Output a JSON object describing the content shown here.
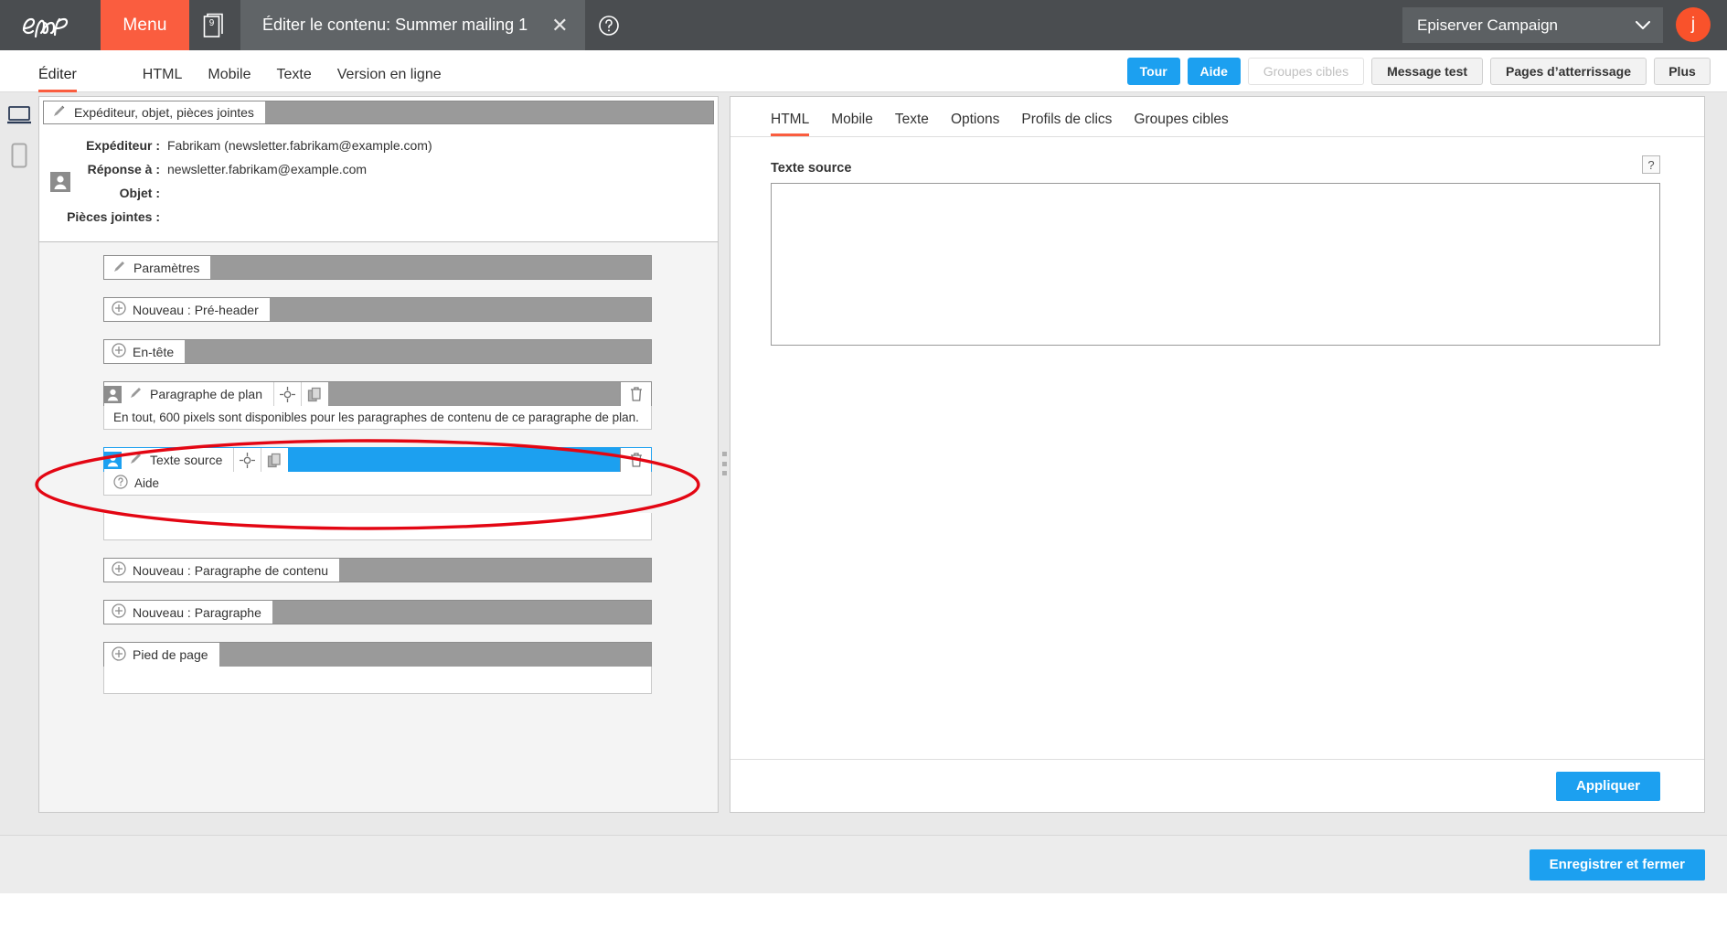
{
  "topbar": {
    "logo_name": "episerver-logo",
    "menu_label": "Menu",
    "doc_badge": "9",
    "title": "Éditer le contenu: Summer mailing 1",
    "close_label": "✕",
    "help_label": "?",
    "environment": "Episerver Campaign",
    "avatar_initial": "j"
  },
  "subbar": {
    "tabs": [
      {
        "label": "Éditer",
        "active": true
      },
      {
        "label": "HTML",
        "active": false
      },
      {
        "label": "Mobile",
        "active": false
      },
      {
        "label": "Texte",
        "active": false
      },
      {
        "label": "Version en ligne",
        "active": false
      }
    ],
    "buttons": [
      {
        "label": "Tour",
        "style": "blue"
      },
      {
        "label": "Aide",
        "style": "blue"
      },
      {
        "label": "Groupes cibles",
        "style": "ghost"
      },
      {
        "label": "Message test",
        "style": "grey"
      },
      {
        "label": "Pages d’atterrissage",
        "style": "grey"
      },
      {
        "label": "Plus",
        "style": "grey"
      }
    ]
  },
  "devicebar": {
    "desktop_icon": "desktop-icon",
    "mobile_icon": "mobile-icon"
  },
  "sender_panel": {
    "header_label": "Expéditeur, objet, pièces jointes",
    "rows": [
      {
        "label": "Expéditeur :",
        "value": "Fabrikam (newsletter.fabrikam@example.com)"
      },
      {
        "label": "Réponse à :",
        "value": "newsletter.fabrikam@example.com"
      },
      {
        "label": "Objet :",
        "value": ""
      },
      {
        "label": "Pièces jointes :",
        "value": ""
      }
    ]
  },
  "blocks": [
    {
      "type": "edit",
      "label": "Paramètres"
    },
    {
      "type": "add",
      "label": "Nouveau : Pré-header"
    },
    {
      "type": "add",
      "label": "En-tête"
    },
    {
      "type": "edit",
      "label": "Paragraphe de plan",
      "avatar": true,
      "tools": true,
      "trash": true,
      "note": "En tout, 600 pixels sont disponibles pour les paragraphes de contenu de ce paragraphe de plan."
    },
    {
      "type": "edit",
      "label": "Texte source",
      "avatar": true,
      "tools": true,
      "trash": true,
      "selected": true,
      "note": "Aide",
      "note_icon": "help-circle-icon"
    },
    {
      "type": "add",
      "label": "Nouveau : Paragraphe de contenu"
    },
    {
      "type": "add",
      "label": "Nouveau : Paragraphe"
    },
    {
      "type": "add",
      "label": "Pied de page"
    }
  ],
  "right_panel": {
    "tabs": [
      {
        "label": "HTML",
        "active": true
      },
      {
        "label": "Mobile",
        "active": false
      },
      {
        "label": "Texte",
        "active": false
      },
      {
        "label": "Options",
        "active": false
      },
      {
        "label": "Profils de clics",
        "active": false
      },
      {
        "label": "Groupes cibles",
        "active": false
      }
    ],
    "field_label": "Texte source",
    "help_label": "?",
    "source_value": "",
    "apply_label": "Appliquer"
  },
  "footer": {
    "save_label": "Enregistrer et fermer"
  },
  "colors": {
    "accent_orange": "#fa5d3f",
    "accent_blue": "#1ca0f0",
    "topbar": "#4a4d50",
    "annotation_red": "#e30613"
  }
}
